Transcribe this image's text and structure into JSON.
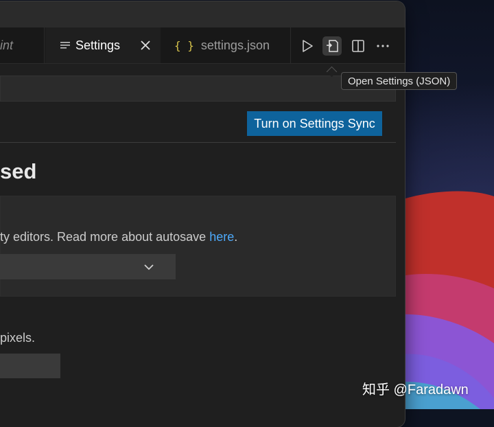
{
  "tabs": [
    {
      "label": "Lint",
      "state": "inactive"
    },
    {
      "label": "Settings",
      "state": "active",
      "icon": "settings-list-icon"
    },
    {
      "label": "settings.json",
      "state": "inactive",
      "icon": "json-braces-icon",
      "icon_text": "{ }"
    }
  ],
  "toolbar": {
    "actions": [
      "run-icon",
      "open-settings-json-icon",
      "split-editor-icon",
      "more-actions-icon"
    ],
    "tooltip": "Open Settings (JSON)"
  },
  "settings": {
    "sync_button_label": "Turn on Settings Sync",
    "section_heading": "sed",
    "auto_save": {
      "description_prefix": "ty editors. Read more about autosave ",
      "link_text": "here",
      "description_suffix": "."
    },
    "font_size": {
      "description": "pixels."
    }
  },
  "watermark": "知乎 @Faradawn",
  "colors": {
    "accent_button": "#0e639c",
    "link": "#4daafc",
    "editor_background": "#1f1f1f",
    "json_icon": "#d7c34b"
  }
}
